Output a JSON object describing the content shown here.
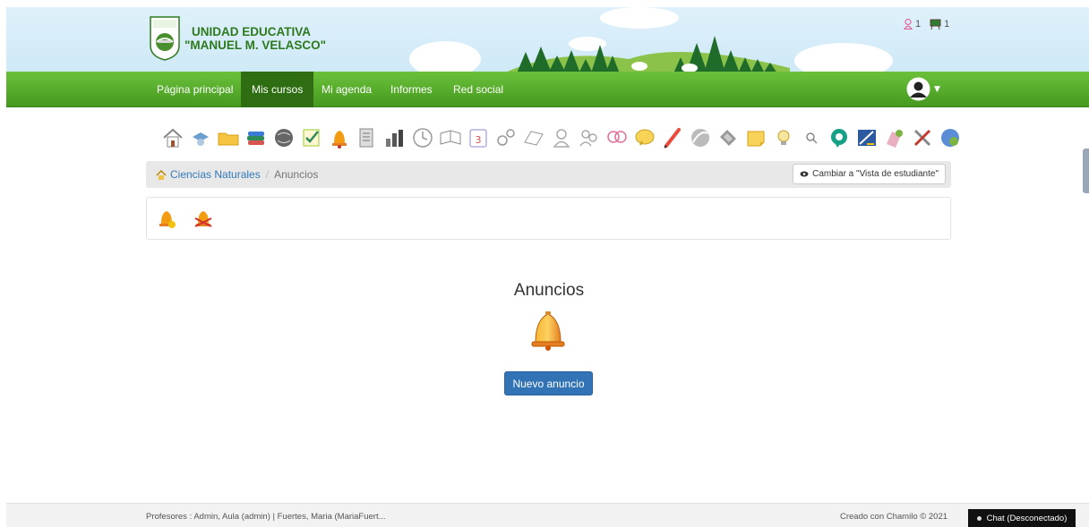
{
  "header": {
    "school_line1": "UNIDAD EDUCATIVA",
    "school_line2": "\"MANUEL M. VELASCO\"",
    "users_online": "1",
    "second_counter": "1"
  },
  "nav": {
    "items": [
      {
        "label": "Página principal"
      },
      {
        "label": "Mis cursos"
      },
      {
        "label": "Mi agenda"
      },
      {
        "label": "Informes"
      },
      {
        "label": "Red social"
      }
    ],
    "active_index": 1
  },
  "toolbar": {
    "icons": [
      "home-icon",
      "course-description-icon",
      "documents-icon",
      "learning-path-icon",
      "links-icon",
      "tests-icon",
      "announcements-icon",
      "assignments-icon",
      "gradebook-icon",
      "attendance-icon",
      "glossary-icon",
      "agenda-icon",
      "groups-icon",
      "chat-icon",
      "users-icon",
      "user-groups-icon",
      "forums-icon",
      "wiki-icon",
      "surveys-icon",
      "notebook-icon",
      "progress-icon",
      "notes-icon",
      "search-icon",
      "lp-chat-icon",
      "dropbox-icon",
      "blog-icon",
      "settings-icon",
      "videoconference-icon"
    ]
  },
  "breadcrumb": {
    "course": "Ciencias Naturales",
    "current": "Anuncios",
    "view_button": "Cambiar a \"Vista de estudiante\""
  },
  "main": {
    "title": "Anuncios",
    "new_button": "Nuevo anuncio"
  },
  "footer": {
    "teachers": "Profesores : Admin, Aula (admin) | Fuertes, Maria (MariaFuert...",
    "credit": "Creado con Chamilo © 2021",
    "chat": "Chat (Desconectado)"
  },
  "colors": {
    "nav_green": "#5aab2d",
    "nav_active": "#2f6d12",
    "primary": "#3273b5",
    "school_green": "#2d7a1e"
  }
}
